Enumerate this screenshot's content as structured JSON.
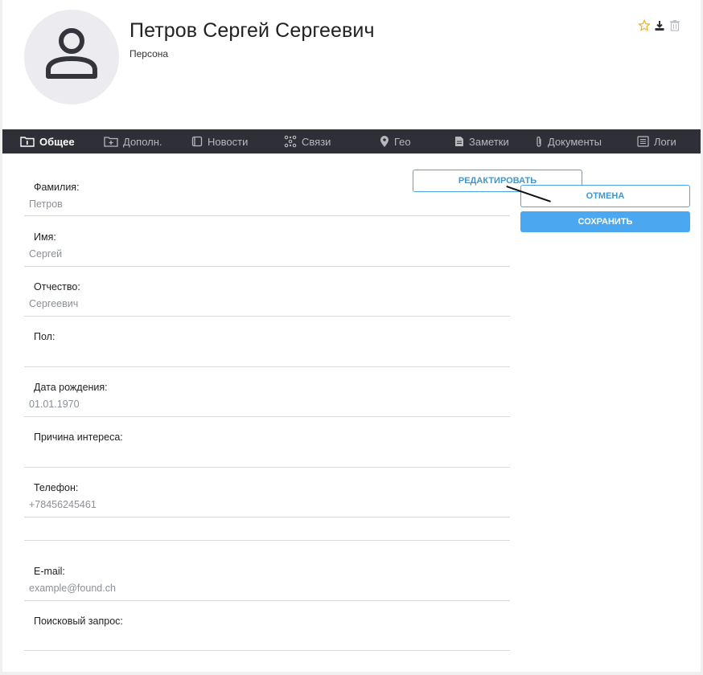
{
  "header": {
    "title": "Петров Сергей Сергеевич",
    "subtitle": "Персона",
    "icons": [
      "star-icon",
      "download-icon",
      "trash-icon"
    ]
  },
  "tabs": [
    {
      "label": "Общее",
      "icon": "info-folder-icon",
      "active": true
    },
    {
      "label": "Дополн.",
      "icon": "add-folder-icon",
      "active": false
    },
    {
      "label": "Новости",
      "icon": "news-icon",
      "active": false
    },
    {
      "label": "Связи",
      "icon": "network-icon",
      "active": false
    },
    {
      "label": "Гео",
      "icon": "map-pin-icon",
      "active": false
    },
    {
      "label": "Заметки",
      "icon": "note-icon",
      "active": false
    },
    {
      "label": "Документы",
      "icon": "paperclip-icon",
      "active": false
    },
    {
      "label": "Логи",
      "icon": "log-icon",
      "active": false
    }
  ],
  "fields": [
    {
      "label": "Фамилия:",
      "value": "Петров"
    },
    {
      "label": "Имя:",
      "value": "Сергей"
    },
    {
      "label": "Отчество:",
      "value": "Сергеевич"
    },
    {
      "label": "Пол:",
      "value": ""
    },
    {
      "label": "Дата рождения:",
      "value": "01.01.1970"
    },
    {
      "label": "Причина интереса:",
      "value": ""
    },
    {
      "label": "Телефон:",
      "value": "+78456245461"
    },
    {
      "label": "",
      "value": ""
    },
    {
      "label": "E-mail:",
      "value": "example@found.ch"
    },
    {
      "label": "Поисковый запрос:",
      "value": ""
    }
  ],
  "actions": {
    "edit": "РЕДАКТИРОВАТЬ",
    "cancel": "ОТМЕНА",
    "save": "СОХРАНИТЬ"
  },
  "colors": {
    "navbar": "#2f2f37",
    "accent": "#4ba7ef",
    "star": "#f2b01e"
  }
}
